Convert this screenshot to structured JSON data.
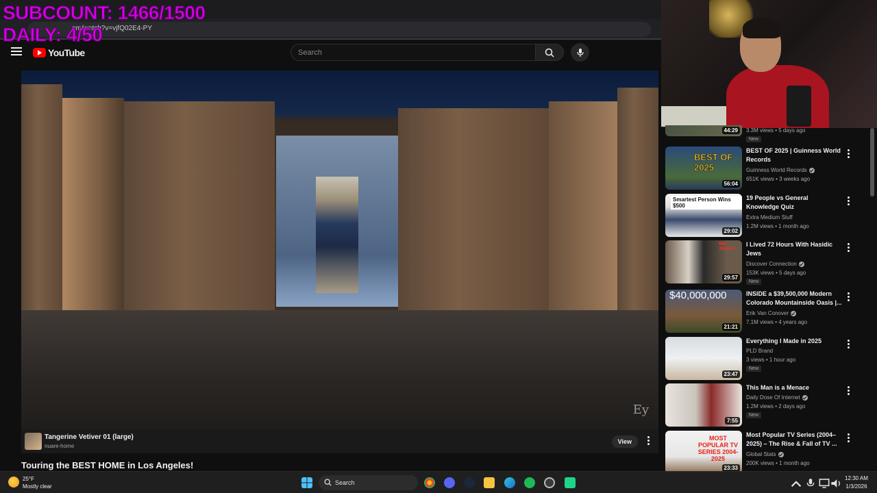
{
  "overlay": {
    "line1": "SUBCOUNT: 1466/1500",
    "line2": "DAILY: 4/50"
  },
  "browser": {
    "url": "om/watch?v=vjfQ02E4-PY"
  },
  "header": {
    "logo_text": "YouTube",
    "search_placeholder": "Search"
  },
  "video": {
    "watermark": "Ey",
    "title": "Touring the BEST HOME in Los Angeles!"
  },
  "infobar": {
    "title": "Tangerine Vetiver 01 (large)",
    "subtitle": "nuare-home",
    "view_label": "View"
  },
  "sidebar": {
    "items": [
      {
        "title": "",
        "channel": "",
        "meta": "3.3M views • 5 days ago",
        "duration": "44:29",
        "badge": "New",
        "verified": false
      },
      {
        "title": "BEST OF 2025 | Guinness World Records",
        "channel": "Guinness World Records",
        "meta": "651K views • 3 weeks ago",
        "duration": "56:04",
        "badge": "",
        "verified": true,
        "thumb_text": "BEST OF 2025"
      },
      {
        "title": "19 People vs General Knowledge Quiz",
        "channel": "Extra Medium Stuff",
        "meta": "1.2M views • 1 month ago",
        "duration": "29:02",
        "badge": "",
        "verified": false,
        "thumb_text": "Smartest Person Wins $500"
      },
      {
        "title": "I Lived 72 Hours With Hasidic Jews",
        "channel": "Discover Connection",
        "meta": "153K views • 5 days ago",
        "duration": "29:57",
        "badge": "New",
        "verified": true,
        "thumb_text": "Not Jewish"
      },
      {
        "title": "INSIDE a $39,500,000 Modern Colorado Mountainside Oasis |...",
        "channel": "Erik Van Conover",
        "meta": "7.1M views • 4 years ago",
        "duration": "21:21",
        "badge": "",
        "verified": true,
        "thumb_text": "$40,000,000"
      },
      {
        "title": "Everything I Made in 2025",
        "channel": "PLD Brand",
        "meta": "3 views • 1 hour ago",
        "duration": "23:47",
        "badge": "New",
        "verified": false
      },
      {
        "title": "This Man is a Menace",
        "channel": "Daily Dose Of Internet",
        "meta": "1.2M views • 2 days ago",
        "duration": "7:55",
        "badge": "New",
        "verified": true
      },
      {
        "title": "Most Popular TV Series (2004–2025) – The Rise & Fall of TV ...",
        "channel": "Global Stats",
        "meta": "200K views • 1 month ago",
        "duration": "23:33",
        "badge": "",
        "verified": true,
        "thumb_text": "MOST POPULAR TV SERIES 2004-2025"
      }
    ]
  },
  "taskbar": {
    "temp": "25°F",
    "condition": "Mostly clear",
    "search_label": "Search",
    "time": "12:30 AM",
    "date": "1/3/2026"
  },
  "colors": {
    "overlay": "#d400e8",
    "yt_red": "#ff0000",
    "background": "#0f0f0f"
  }
}
